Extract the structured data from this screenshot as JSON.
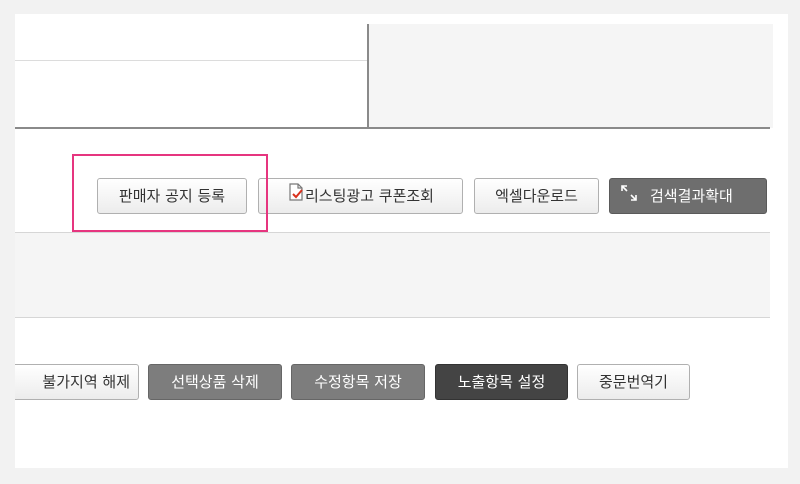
{
  "toolbar_top": {
    "notice_button": "판매자 공지 등록",
    "coupon_button": "리스팅광고 쿠폰조회",
    "excel_button": "엑셀다운로드",
    "expand_button": "검색결과확대"
  },
  "toolbar_bottom": {
    "region_button": "불가지역 해제",
    "delete_button": "선택상품 삭제",
    "save_button": "수정항목 저장",
    "expose_button": "노출항목 설정",
    "translate_button": "중문번역기"
  },
  "colors": {
    "highlight": "#e6357f",
    "dark_button": "#6e6e6e",
    "darker_button": "#444444"
  }
}
